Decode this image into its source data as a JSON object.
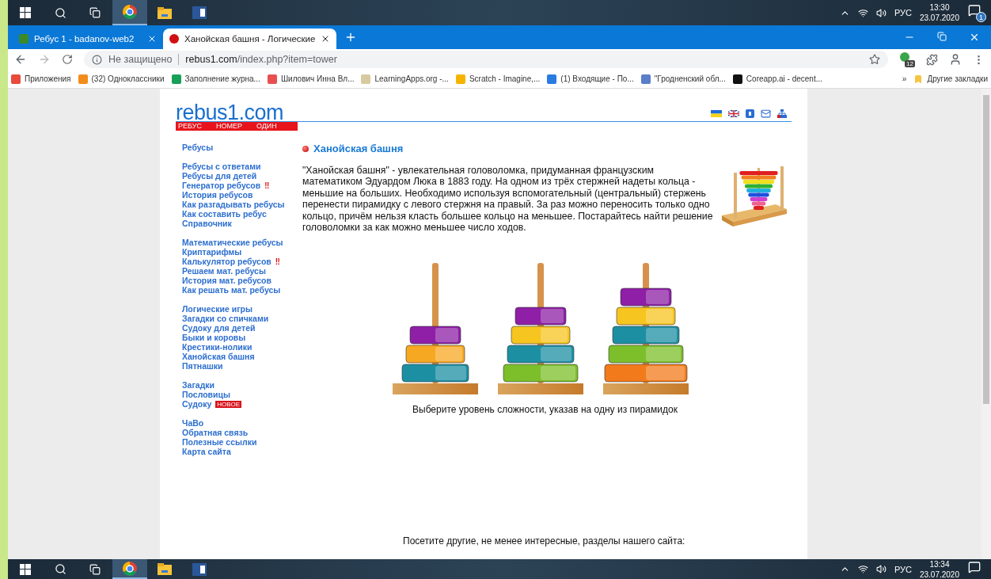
{
  "taskbar_top": {
    "tray_language": "РУС",
    "time": "13:30",
    "date": "23.07.2020",
    "notification_count": "1"
  },
  "browser": {
    "tabs": [
      {
        "title": "Ребус 1 - badanov-web2",
        "selected": false
      },
      {
        "title": "Ханойская башня - Логические",
        "selected": true
      }
    ],
    "security": "Не защищено",
    "url_host": "rebus1.com",
    "url_path": "/index.php?item=tower",
    "extension_badge": "12",
    "bookmarks": [
      "Приложения",
      "(32) Одноклассники",
      "Заполнение журна...",
      "Шилович Инна Вл...",
      "LearningApps.org -...",
      "Scratch - Imagine,...",
      "(1) Входящие - По...",
      "\"Гродненский обл...",
      "Coreapp.ai - decent..."
    ],
    "other_bookmarks": "Другие закладки",
    "overflow": "»"
  },
  "page": {
    "logo": {
      "name": "rebus1.com",
      "band": [
        "РЕБУС",
        "НОМЕР",
        "ОДИН"
      ]
    },
    "menu_groups": [
      {
        "items": [
          {
            "label": "Ребусы"
          }
        ]
      },
      {
        "items": [
          {
            "label": "Ребусы с ответами"
          },
          {
            "label": "Ребусы для детей"
          },
          {
            "label": "Генератор ребусов",
            "mark": "‼"
          },
          {
            "label": "История ребусов"
          },
          {
            "label": "Как разгадывать ребусы"
          },
          {
            "label": "Как составить ребус"
          },
          {
            "label": "Справочник"
          }
        ]
      },
      {
        "items": [
          {
            "label": "Математические ребусы"
          },
          {
            "label": "Криптарифмы"
          },
          {
            "label": "Калькулятор ребусов",
            "mark": "‼"
          },
          {
            "label": "Решаем мат. ребусы"
          },
          {
            "label": "История мат. ребусов"
          },
          {
            "label": "Как решать мат. ребусы"
          }
        ]
      },
      {
        "items": [
          {
            "label": "Логические игры"
          },
          {
            "label": "Загадки со спичками"
          },
          {
            "label": "Судоку для детей"
          },
          {
            "label": "Быки и коровы"
          },
          {
            "label": "Крестики-нолики"
          },
          {
            "label": "Ханойская башня"
          },
          {
            "label": "Пятнашки"
          }
        ]
      },
      {
        "items": [
          {
            "label": "Загадки"
          },
          {
            "label": "Пословицы"
          },
          {
            "label": "Судоку",
            "badge": "НОВОЕ"
          }
        ]
      },
      {
        "items": [
          {
            "label": "ЧаВо"
          },
          {
            "label": "Обратная связь"
          },
          {
            "label": "Полезные ссылки"
          },
          {
            "label": "Карта сайта"
          }
        ]
      }
    ],
    "title": "Ханойская башня",
    "description": "\"Ханойская башня\" - увлекательная головоломка, придуманная французским математиком Эдуардом Люка в 1883 году. На одном из трёх стержней надеты кольца - меньшие на больших. Необходимо используя вспомогательный (центральный) стержень перенести пирамидку с левого стержня на правый. За раз можно переносить только одно кольцо, причём нельзя класть большее кольцо на меньшее. Постарайтесь найти решение головоломки за как можно меньшее число ходов.",
    "towers": [
      {
        "rings": [
          {
            "color": "#8e1fa6"
          },
          {
            "color": "#f7a823"
          },
          {
            "color": "#1d8fa3"
          }
        ]
      },
      {
        "rings": [
          {
            "color": "#8e1fa6"
          },
          {
            "color": "#f7c51f"
          },
          {
            "color": "#1d8fa3"
          },
          {
            "color": "#7cbf2a"
          }
        ]
      },
      {
        "rings": [
          {
            "color": "#8e1fa6"
          },
          {
            "color": "#f7c51f"
          },
          {
            "color": "#1d8fa3"
          },
          {
            "color": "#7cbf2a"
          },
          {
            "color": "#f27a1a"
          }
        ]
      }
    ],
    "prompt": "Выберите уровень сложности, указав на одну из пирамидок",
    "footer_text": "Посетите другие, не менее интересные, разделы нашего сайта:"
  },
  "taskbar_bottom": {
    "tray_language": "РУС",
    "time": "13:34",
    "date": "23.07.2020"
  }
}
